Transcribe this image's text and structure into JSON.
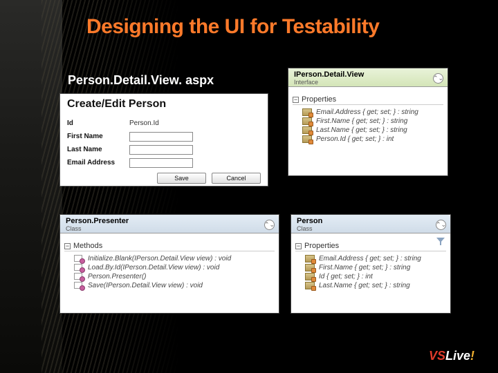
{
  "title": "Designing the UI for Testability",
  "filename": "Person.Detail.View. aspx",
  "form": {
    "heading": "Create/Edit Person",
    "fields": {
      "id_label": "Id",
      "id_value": "Person.Id",
      "first_label": "First Name",
      "last_label": "Last Name",
      "email_label": "Email Address"
    },
    "save_label": "Save",
    "cancel_label": "Cancel"
  },
  "interface_box": {
    "name": "IPerson.Detail.View",
    "stereotype": "Interface",
    "section": "Properties",
    "members": [
      "Email.Address { get; set; } : string",
      "First.Name { get; set; } : string",
      "Last.Name { get; set; } : string",
      "Person.Id { get; set; } : int"
    ]
  },
  "presenter_box": {
    "name": "Person.Presenter",
    "stereotype": "Class",
    "section": "Methods",
    "members": [
      "Initialize.Blank(IPerson.Detail.View view) : void",
      "Load.By.Id(IPerson.Detail.View view) : void",
      "Person.Presenter()",
      "Save(IPerson.Detail.View view) : void"
    ]
  },
  "person_box": {
    "name": "Person",
    "stereotype": "Class",
    "section": "Properties",
    "members": [
      "Email.Address { get; set; } : string",
      "First.Name { get; set; } : string",
      "Id { get; set; } : int",
      "Last.Name { get; set; } : string"
    ]
  },
  "logo": {
    "vs": "VS",
    "live": "Live",
    "bang": "!"
  }
}
